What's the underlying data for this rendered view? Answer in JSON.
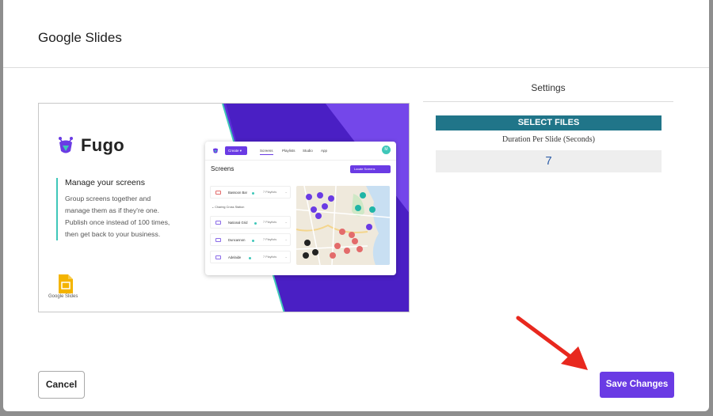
{
  "modal": {
    "title": "Google Slides"
  },
  "preview": {
    "brand": "Fugo",
    "feature_heading": "Manage your screens",
    "feature_lines": [
      "Group screens together and",
      "manage them as if they're one.",
      "Publish once instead of 100 times,",
      "then get back to your business."
    ],
    "app_label": "Google Slides",
    "mock_app": {
      "create_label": "Create",
      "nav": [
        "Screens",
        "Playlists",
        "Studio",
        "App"
      ],
      "avatar": "M",
      "title": "Screens",
      "launch_label": "Locate Screens",
      "group_label": "Charing Cross Station",
      "rows": [
        {
          "name": "Bassoon Bar",
          "playlists": "7 Playlists"
        },
        {
          "name": "National Grid",
          "playlists": "7 Playlists"
        },
        {
          "name": "Duncannon",
          "playlists": "7 Playlists"
        },
        {
          "name": "Adelaide",
          "playlists": "7 Playlists"
        }
      ],
      "more": "..."
    },
    "colors": {
      "purple": "#6a3be4",
      "teal": "#3fc7b9",
      "deep_purple": "#4a1fc4"
    }
  },
  "settings": {
    "title": "Settings",
    "select_files_label": "SELECT FILES",
    "duration_label": "Duration Per Slide (Seconds)",
    "duration_value": "7",
    "colors": {
      "select_files_bg": "#207589",
      "duration_text": "#2f5fa8"
    }
  },
  "footer": {
    "cancel_label": "Cancel",
    "save_label": "Save Changes",
    "colors": {
      "save_bg": "#6a3be4",
      "annotation_arrow": "#e8281e"
    }
  }
}
